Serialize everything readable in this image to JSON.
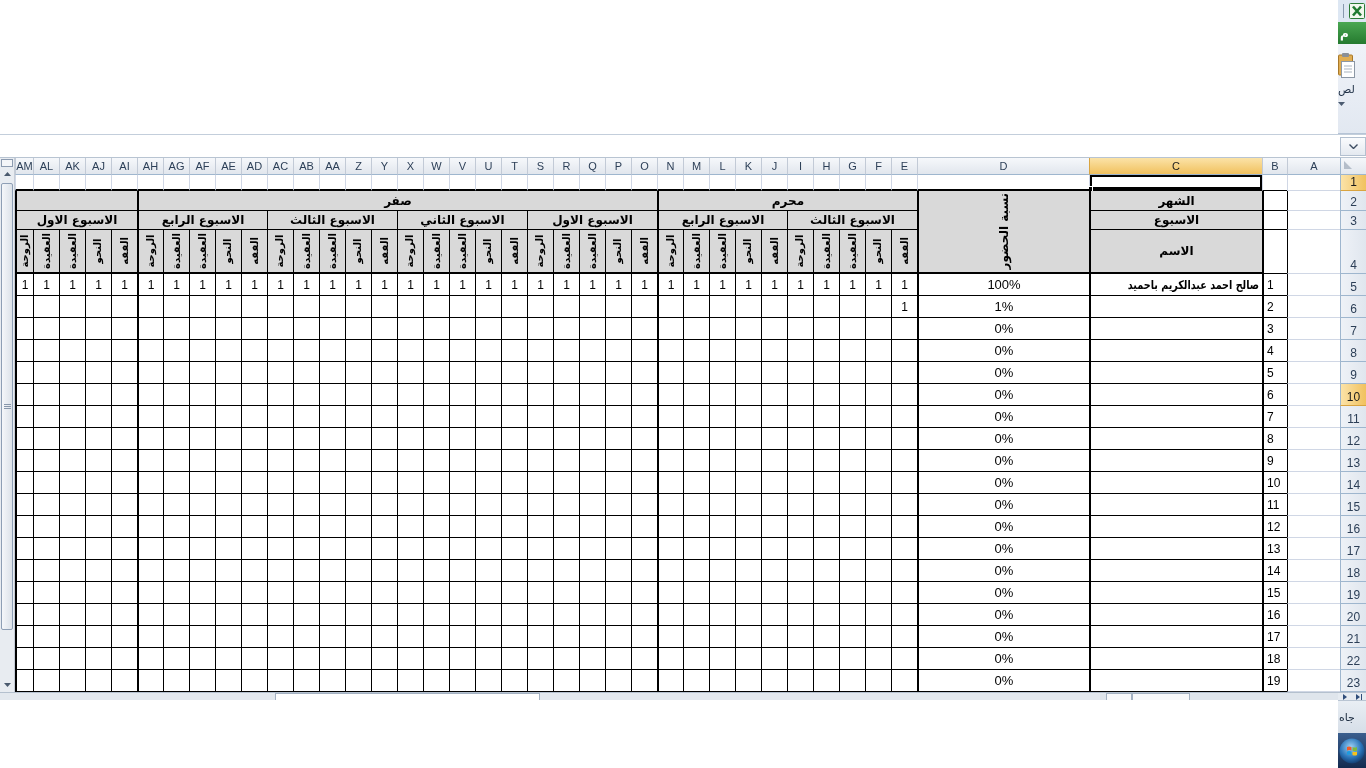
{
  "ribbon": {
    "file_tab": "م",
    "paste_label": "لص"
  },
  "column_headers": [
    {
      "label": "A",
      "selected": false,
      "active": false
    },
    {
      "label": "B",
      "selected": false,
      "active": false
    },
    {
      "label": "C",
      "selected": true,
      "active": true
    },
    {
      "label": "D",
      "selected": false,
      "active": false
    },
    {
      "label": "E",
      "selected": false,
      "active": false
    },
    {
      "label": "F",
      "selected": false,
      "active": false
    },
    {
      "label": "G",
      "selected": false,
      "active": false
    },
    {
      "label": "H",
      "selected": false,
      "active": false
    },
    {
      "label": "I",
      "selected": false,
      "active": false
    },
    {
      "label": "J",
      "selected": false,
      "active": false
    },
    {
      "label": "K",
      "selected": false,
      "active": false
    },
    {
      "label": "L",
      "selected": false,
      "active": false
    },
    {
      "label": "M",
      "selected": false,
      "active": false
    },
    {
      "label": "N",
      "selected": false,
      "active": false
    },
    {
      "label": "O",
      "selected": false,
      "active": false
    },
    {
      "label": "P",
      "selected": false,
      "active": false
    },
    {
      "label": "Q",
      "selected": false,
      "active": false
    },
    {
      "label": "R",
      "selected": false,
      "active": false
    },
    {
      "label": "S",
      "selected": false,
      "active": false
    },
    {
      "label": "T",
      "selected": false,
      "active": false
    },
    {
      "label": "U",
      "selected": false,
      "active": false
    },
    {
      "label": "V",
      "selected": false,
      "active": false
    },
    {
      "label": "W",
      "selected": false,
      "active": false
    },
    {
      "label": "X",
      "selected": false,
      "active": false
    },
    {
      "label": "Y",
      "selected": false,
      "active": false
    },
    {
      "label": "Z",
      "selected": false,
      "active": false
    },
    {
      "label": "AA",
      "selected": false,
      "active": false
    },
    {
      "label": "AB",
      "selected": false,
      "active": false
    },
    {
      "label": "AC",
      "selected": false,
      "active": false
    },
    {
      "label": "AD",
      "selected": false,
      "active": false
    },
    {
      "label": "AE",
      "selected": false,
      "active": false
    },
    {
      "label": "AF",
      "selected": false,
      "active": false
    },
    {
      "label": "AG",
      "selected": false,
      "active": false
    },
    {
      "label": "AH",
      "selected": false,
      "active": false
    },
    {
      "label": "AI",
      "selected": false,
      "active": false
    },
    {
      "label": "AJ",
      "selected": false,
      "active": false
    },
    {
      "label": "AK",
      "selected": false,
      "active": false
    },
    {
      "label": "AL",
      "selected": false,
      "active": false
    },
    {
      "label": "AM",
      "selected": false,
      "active": false
    }
  ],
  "row_headers": [
    {
      "label": "1",
      "selected": true,
      "active": true
    },
    {
      "label": "2",
      "selected": false,
      "active": false
    },
    {
      "label": "3",
      "selected": false,
      "active": false
    },
    {
      "label": "4",
      "selected": false,
      "active": false
    },
    {
      "label": "5",
      "selected": false,
      "active": false
    },
    {
      "label": "6",
      "selected": false,
      "active": false
    },
    {
      "label": "7",
      "selected": false,
      "active": false
    },
    {
      "label": "8",
      "selected": false,
      "active": false
    },
    {
      "label": "9",
      "selected": false,
      "active": false
    },
    {
      "label": "10",
      "selected": true,
      "active": false
    },
    {
      "label": "11",
      "selected": false,
      "active": false
    },
    {
      "label": "12",
      "selected": false,
      "active": false
    },
    {
      "label": "13",
      "selected": false,
      "active": false
    },
    {
      "label": "14",
      "selected": false,
      "active": false
    },
    {
      "label": "15",
      "selected": false,
      "active": false
    },
    {
      "label": "16",
      "selected": false,
      "active": false
    },
    {
      "label": "17",
      "selected": false,
      "active": false
    },
    {
      "label": "18",
      "selected": false,
      "active": false
    },
    {
      "label": "19",
      "selected": false,
      "active": false
    },
    {
      "label": "20",
      "selected": false,
      "active": false
    },
    {
      "label": "21",
      "selected": false,
      "active": false
    },
    {
      "label": "22",
      "selected": false,
      "active": false
    },
    {
      "label": "23",
      "selected": false,
      "active": false
    }
  ],
  "sheet": {
    "labels": {
      "month": "الشهر",
      "week": "الاسبوع",
      "name": "الاسم",
      "attendance": "نسبة الحضور"
    },
    "months": [
      {
        "name": "محرم",
        "weeks": [
          {
            "name": "الاسبوع الثالث",
            "subjects": [
              "الفقه",
              "النحو",
              "العقيدة",
              "العقيدة",
              "الروحة"
            ]
          },
          {
            "name": "الاسبوع الرابع",
            "subjects": [
              "الفقه",
              "النحو",
              "العقيدة",
              "العقيدة",
              "الروحة"
            ]
          }
        ]
      },
      {
        "name": "صفر",
        "weeks": [
          {
            "name": "الاسبوع الاول",
            "subjects": [
              "الفقه",
              "النحو",
              "العقيدة",
              "العقيدة",
              "الروحة"
            ]
          },
          {
            "name": "الاسبوع الثاني",
            "subjects": [
              "الفقه",
              "النحو",
              "العقيدة",
              "العقيدة",
              "الروحة"
            ]
          },
          {
            "name": "الاسبوع الثالث",
            "subjects": [
              "الفقه",
              "النحو",
              "العقيدة",
              "العقيدة",
              "الروحة"
            ]
          },
          {
            "name": "الاسبوع الرابع",
            "subjects": [
              "الفقه",
              "النحو",
              "العقيدة",
              "العقيدة",
              "الروحة"
            ]
          }
        ]
      },
      {
        "weeks": [
          {
            "name": "الاسبوع الاول",
            "subjects": [
              "الفقه",
              "النحو",
              "العقيدة",
              "العقيدة",
              "الروحة"
            ]
          }
        ]
      }
    ],
    "students": [
      {
        "number": "1",
        "name": "صالح احمد عبدالكريم باحميد",
        "attendance": "100%",
        "marks": [
          "1",
          "1",
          "1",
          "1",
          "1",
          "1",
          "1",
          "1",
          "1",
          "1",
          "1",
          "1",
          "1",
          "1",
          "1",
          "1",
          "1",
          "1",
          "1",
          "1",
          "1",
          "1",
          "1",
          "1",
          "1",
          "1",
          "1",
          "1",
          "1",
          "1",
          "1",
          "1",
          "1",
          "1",
          "1"
        ]
      },
      {
        "number": "2",
        "attendance": "1%",
        "marks": [
          "1"
        ]
      },
      {
        "number": "3",
        "attendance": "0%"
      },
      {
        "number": "4",
        "attendance": "0%"
      },
      {
        "number": "5",
        "attendance": "0%"
      },
      {
        "number": "6",
        "attendance": "0%"
      },
      {
        "number": "7",
        "attendance": "0%"
      },
      {
        "number": "8",
        "attendance": "0%"
      },
      {
        "number": "9",
        "attendance": "0%"
      },
      {
        "number": "10",
        "attendance": "0%"
      },
      {
        "number": "11",
        "attendance": "0%"
      },
      {
        "number": "12",
        "attendance": "0%"
      },
      {
        "number": "13",
        "attendance": "0%"
      },
      {
        "number": "14",
        "attendance": "0%"
      },
      {
        "number": "15",
        "attendance": "0%"
      },
      {
        "number": "16",
        "attendance": "0%"
      },
      {
        "number": "17",
        "attendance": "0%"
      },
      {
        "number": "18",
        "attendance": "0%"
      },
      {
        "number": "19",
        "attendance": "0%"
      }
    ]
  },
  "status_bar": {
    "text": "جاه"
  }
}
